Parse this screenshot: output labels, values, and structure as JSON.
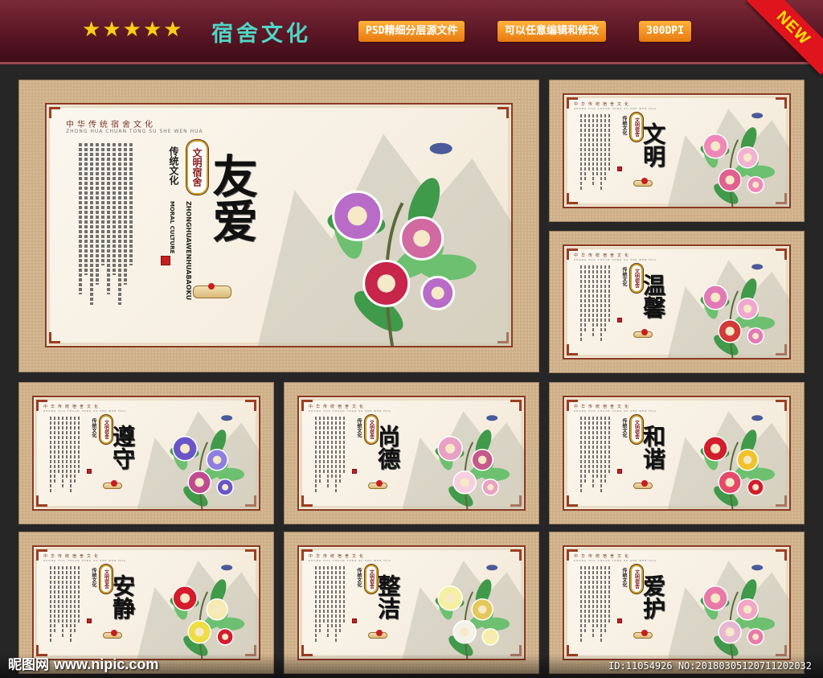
{
  "header": {
    "stars": [
      "★",
      "★",
      "★",
      "★",
      "★"
    ],
    "title": "宿舍文化",
    "badges": [
      "PSD精细分层源文件",
      "可以任意编辑和修改",
      "300DPI"
    ],
    "new_label": "NEW"
  },
  "common": {
    "heading": "中华传统宿舍文化",
    "pinyin": "ZHONG HUA CHUAN TONG SU SHE WEN HUA",
    "tradition": "传统文化",
    "seal": "文明宿舍",
    "moral": "MORAL CULTURE",
    "vertical_pinyin": "ZHONGHUAWENHUABAOKU"
  },
  "panels": [
    {
      "id": "youai",
      "title": "友爱"
    },
    {
      "id": "wenming",
      "title": "文明"
    },
    {
      "id": "wenxin",
      "title": "温馨"
    },
    {
      "id": "zunshou",
      "title": "遵守"
    },
    {
      "id": "shangde",
      "title": "尚德"
    },
    {
      "id": "hexie",
      "title": "和谐"
    },
    {
      "id": "anjing",
      "title": "安静"
    },
    {
      "id": "zhengjie",
      "title": "整洁"
    },
    {
      "id": "aihu",
      "title": "爱护"
    }
  ],
  "watermark": {
    "brand": "昵图网",
    "site": "www.nipic.com",
    "id_text": "ID:11054926 NO:20180305120711202032"
  },
  "colors": {
    "header_bg": "#5a1624",
    "title_color": "#4fd6c6",
    "badge_orange": "#f39a20",
    "frame_tan": "#cdb08a",
    "frame_border": "#8a3a22",
    "ribbon_red": "#e0141c"
  }
}
